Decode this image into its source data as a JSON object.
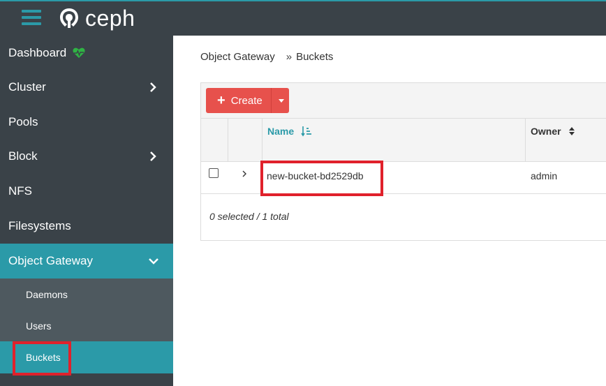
{
  "app": {
    "logo_text": "ceph",
    "brand_color": "#2b9aa8",
    "accent_color": "#e7514c"
  },
  "sidebar": {
    "items": [
      {
        "label": "Dashboard",
        "icon": "heart-pulse-icon"
      },
      {
        "label": "Cluster",
        "icon": "chevron-right-icon"
      },
      {
        "label": "Pools"
      },
      {
        "label": "Block",
        "icon": "chevron-right-icon"
      },
      {
        "label": "NFS"
      },
      {
        "label": "Filesystems"
      },
      {
        "label": "Object Gateway",
        "icon": "chevron-down-icon",
        "expanded": true
      }
    ],
    "sub_items": [
      {
        "label": "Daemons"
      },
      {
        "label": "Users"
      },
      {
        "label": "Buckets",
        "selected": true
      }
    ]
  },
  "breadcrumb": {
    "parent": "Object Gateway",
    "separator": "»",
    "current": "Buckets"
  },
  "toolbar": {
    "create_label": "Create"
  },
  "table": {
    "columns": [
      {
        "label": "Name",
        "sort": "ascending"
      },
      {
        "label": "Owner",
        "sort": "none"
      }
    ],
    "rows": [
      {
        "name": "new-bucket-bd2529db",
        "owner": "admin"
      }
    ],
    "footer": "0 selected / 1 total"
  }
}
